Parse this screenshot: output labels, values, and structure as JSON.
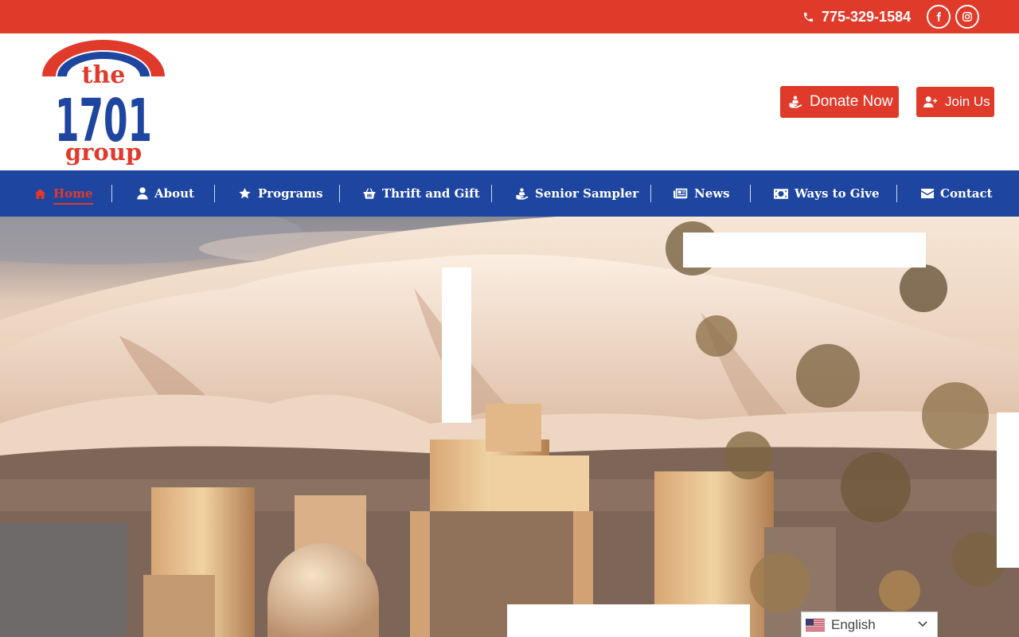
{
  "topbar": {
    "phone": "775-329-1584",
    "icons": [
      "phone-icon",
      "facebook-icon",
      "instagram-icon"
    ]
  },
  "header": {
    "logo": {
      "line1": "the",
      "line2": "1701",
      "line3": "group"
    },
    "donate_label": "Donate Now",
    "join_label": "Join Us"
  },
  "nav": {
    "items": [
      {
        "label": "Home",
        "icon": "home-icon",
        "active": true
      },
      {
        "label": "About",
        "icon": "user-icon"
      },
      {
        "label": "Programs",
        "icon": "star-icon"
      },
      {
        "label": "Thrift and Gift",
        "icon": "basket-icon"
      },
      {
        "label": "Senior Sampler",
        "icon": "hand-giving-icon"
      },
      {
        "label": "News",
        "icon": "newspaper-icon"
      },
      {
        "label": "Ways to Give",
        "icon": "money-icon"
      },
      {
        "label": "Contact",
        "icon": "envelope-icon"
      }
    ]
  },
  "language": {
    "selected": "English",
    "icon": "us-flag-icon"
  },
  "colors": {
    "brand_red": "#e03a2a",
    "brand_blue": "#1e45a0",
    "white": "#ffffff"
  }
}
